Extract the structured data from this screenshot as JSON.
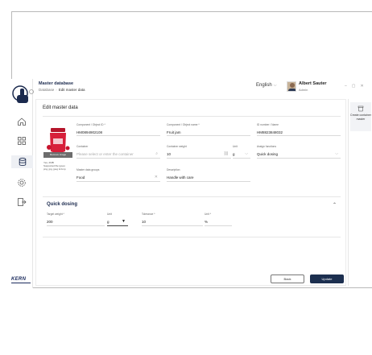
{
  "header": {
    "title": "Master database",
    "breadcrumb_root": "Database",
    "breadcrumb_current": "Edit master data",
    "language": "English",
    "user_name": "Albert Sauter",
    "user_role": "Admin"
  },
  "card": {
    "title": "Edit master data",
    "image_label": "Remove image",
    "image_info_1": "Yes, 2MB",
    "image_info_2": "Supported file types:",
    "image_info_3": "png, jpg, jpeg & bmp"
  },
  "fields": {
    "component_id": {
      "label": "Component / Object ID *",
      "value": "HM0894902108"
    },
    "component_name": {
      "label": "Component / Object name *",
      "value": "Fruit jam"
    },
    "id_number": {
      "label": "ID number / Name",
      "value": "HM8823848032"
    },
    "container": {
      "label": "Container",
      "placeholder": "Please select or enter the container"
    },
    "container_weight": {
      "label": "Container weight",
      "value": "10"
    },
    "container_unit": {
      "label": "Unit",
      "value": "g"
    },
    "assign_functions": {
      "label": "Assign functions",
      "value": "Quick dosing"
    },
    "master_data_groups": {
      "label": "Master data groups",
      "value": "Food"
    },
    "description": {
      "label": "Description",
      "value": "Handle with care"
    }
  },
  "quick_dosing": {
    "title": "Quick dosing",
    "target_weight": {
      "label": "Target weight *",
      "value": "200"
    },
    "unit": {
      "label": "Unit",
      "value": "g"
    },
    "tolerance": {
      "label": "Tolerance *",
      "value": "10"
    },
    "tolerance_unit": {
      "label": "Unit *",
      "value": "%"
    }
  },
  "buttons": {
    "back": "Back",
    "update": "Update"
  },
  "right_panel": {
    "create_container": "Create container master"
  },
  "brand": "KERN"
}
